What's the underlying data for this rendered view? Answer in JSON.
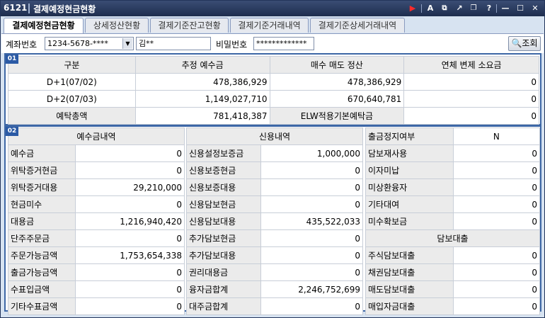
{
  "window": {
    "code": "6121",
    "title": "결제예정현금현황",
    "title_buttons": [
      "flag-icon",
      "font-icon",
      "new-window-icon",
      "pin-icon",
      "restore-icon",
      "help-icon",
      "minimize-icon",
      "maximize-icon",
      "close-icon"
    ]
  },
  "tabs": [
    "결제예정현금현황",
    "상세정산현황",
    "결제기준잔고현황",
    "결제기준거래내역",
    "결제기준상세거래내역"
  ],
  "toolbar": {
    "account_label": "계좌번호",
    "account_value": "1234-5678-****",
    "name_value": "김**",
    "password_label": "비밀번호",
    "password_value": "*************",
    "search_label": "조회"
  },
  "section1": {
    "num": "01",
    "headers": [
      "구분",
      "추정 예수금",
      "매수 매도 정산",
      "연체 변제 소요금"
    ],
    "rows": [
      {
        "label": "D+1(07/02)",
        "est": "478,386,929",
        "settle": "478,386,929",
        "overdue": "0"
      },
      {
        "label": "D+2(07/03)",
        "est": "1,149,027,710",
        "settle": "670,640,781",
        "overdue": "0"
      }
    ],
    "deposit_label": "예탁총액",
    "deposit_value": "781,418,387",
    "elw_label": "ELW적용기본예탁금",
    "elw_value": "0"
  },
  "section2": {
    "num": "02",
    "deposit": {
      "title": "예수금내역",
      "rows": [
        {
          "label": "예수금",
          "value": "0"
        },
        {
          "label": "위탁증거현금",
          "value": "0"
        },
        {
          "label": "위탁증거대용",
          "value": "29,210,000"
        },
        {
          "label": "현금미수",
          "value": "0"
        },
        {
          "label": "대용금",
          "value": "1,216,940,420"
        },
        {
          "label": "단주주문금",
          "value": "0"
        },
        {
          "label": "주문가능금액",
          "value": "1,753,654,338"
        },
        {
          "label": "출금가능금액",
          "value": "0"
        },
        {
          "label": "수표입금액",
          "value": "0"
        },
        {
          "label": "기타수표금액",
          "value": "0"
        }
      ]
    },
    "credit": {
      "title": "신용내역",
      "rows": [
        {
          "label": "신용설정보증금",
          "value": "1,000,000"
        },
        {
          "label": "신용보증현금",
          "value": "0"
        },
        {
          "label": "신용보증대용",
          "value": "0"
        },
        {
          "label": "신용담보현금",
          "value": "0"
        },
        {
          "label": "신용담보대용",
          "value": "435,522,033"
        },
        {
          "label": "추가담보현금",
          "value": "0"
        },
        {
          "label": "추가담보대용",
          "value": "0"
        },
        {
          "label": "권리대용금",
          "value": "0"
        },
        {
          "label": "융자금합계",
          "value": "2,246,752,699"
        },
        {
          "label": "대주금합계",
          "value": "0"
        }
      ]
    },
    "misc": {
      "stop_label": "출금정지여부",
      "stop_value": "N",
      "rows": [
        {
          "label": "담보재사용",
          "value": "0"
        },
        {
          "label": "이자미납",
          "value": "0"
        },
        {
          "label": "미상환융자",
          "value": "0"
        },
        {
          "label": "기타대여",
          "value": "0"
        },
        {
          "label": "미수확보금",
          "value": "0"
        }
      ],
      "loan_title": "담보대출",
      "loan_rows": [
        {
          "label": "주식담보대출",
          "value": "0"
        },
        {
          "label": "채권담보대출",
          "value": "0"
        },
        {
          "label": "매도담보대출",
          "value": "0"
        },
        {
          "label": "매입자금대출",
          "value": "0"
        }
      ]
    }
  }
}
